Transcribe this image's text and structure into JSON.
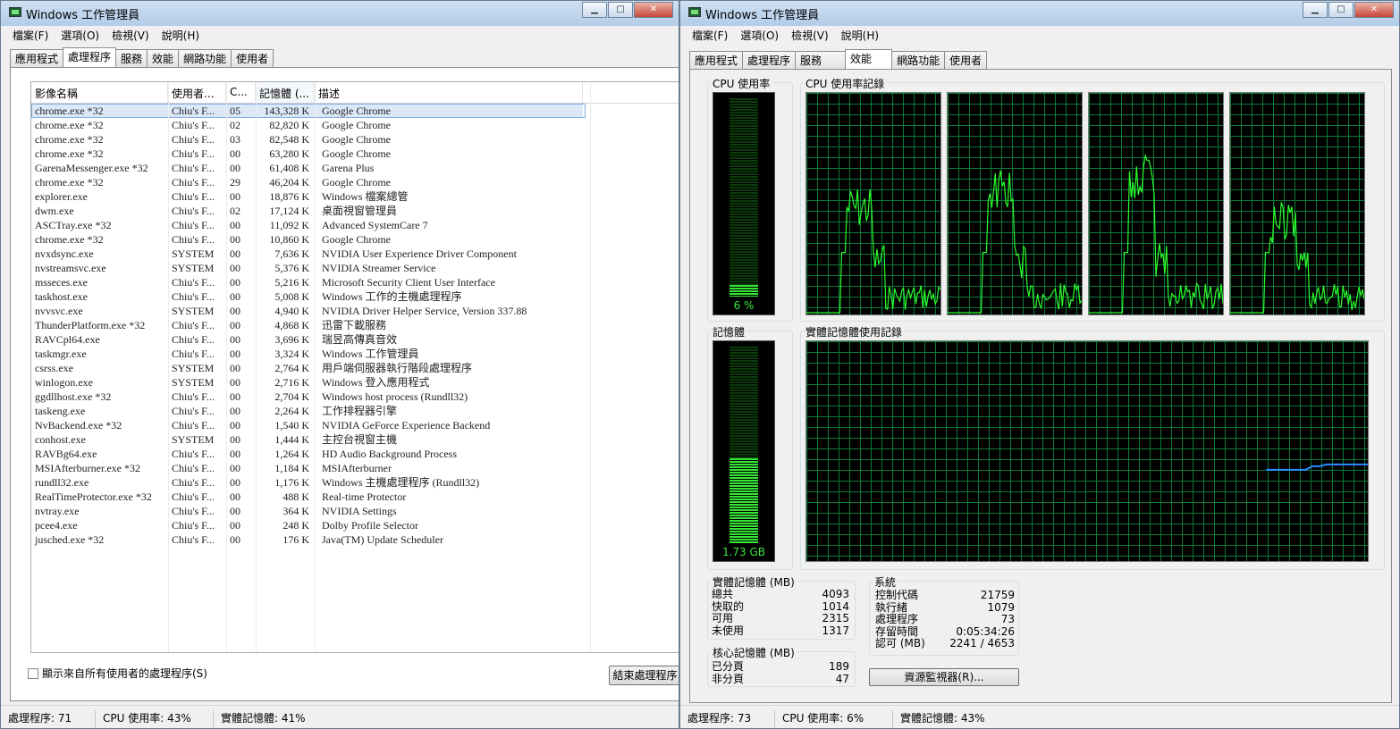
{
  "left": {
    "title": "Windows 工作管理員",
    "menus": [
      "檔案(F)",
      "選項(O)",
      "檢視(V)",
      "說明(H)"
    ],
    "tabs": [
      "應用程式",
      "處理程序",
      "服務",
      "效能",
      "網路功能",
      "使用者"
    ],
    "active_tab": 1,
    "columns": [
      "影像名稱",
      "使用者...",
      "C...",
      "記憶體 (...",
      "描述"
    ],
    "rows": [
      [
        "chrome.exe *32",
        "Chiu's F...",
        "05",
        "143,328 K",
        "Google Chrome"
      ],
      [
        "chrome.exe *32",
        "Chiu's F...",
        "02",
        "82,820 K",
        "Google Chrome"
      ],
      [
        "chrome.exe *32",
        "Chiu's F...",
        "03",
        "82,548 K",
        "Google Chrome"
      ],
      [
        "chrome.exe *32",
        "Chiu's F...",
        "00",
        "63,280 K",
        "Google Chrome"
      ],
      [
        "GarenaMessenger.exe *32",
        "Chiu's F...",
        "00",
        "61,408 K",
        "Garena Plus"
      ],
      [
        "chrome.exe *32",
        "Chiu's F...",
        "29",
        "46,204 K",
        "Google Chrome"
      ],
      [
        "explorer.exe",
        "Chiu's F...",
        "00",
        "18,876 K",
        "Windows 檔案總管"
      ],
      [
        "dwm.exe",
        "Chiu's F...",
        "02",
        "17,124 K",
        "桌面視窗管理員"
      ],
      [
        "ASCTray.exe *32",
        "Chiu's F...",
        "00",
        "11,092 K",
        "Advanced SystemCare 7"
      ],
      [
        "chrome.exe *32",
        "Chiu's F...",
        "00",
        "10,860 K",
        "Google Chrome"
      ],
      [
        "nvxdsync.exe",
        "SYSTEM",
        "00",
        "7,636 K",
        "NVIDIA User Experience Driver Component"
      ],
      [
        "nvstreamsvc.exe",
        "SYSTEM",
        "00",
        "5,376 K",
        "NVIDIA Streamer Service"
      ],
      [
        "msseces.exe",
        "Chiu's F...",
        "00",
        "5,216 K",
        "Microsoft Security Client User Interface"
      ],
      [
        "taskhost.exe",
        "Chiu's F...",
        "00",
        "5,008 K",
        "Windows 工作的主機處理程序"
      ],
      [
        "nvvsvc.exe",
        "SYSTEM",
        "00",
        "4,940 K",
        "NVIDIA Driver Helper Service, Version 337.88"
      ],
      [
        "ThunderPlatform.exe *32",
        "Chiu's F...",
        "00",
        "4,868 K",
        "迅雷下載服務"
      ],
      [
        "RAVCpl64.exe",
        "Chiu's F...",
        "00",
        "3,696 K",
        "瑞昱高傳真音效"
      ],
      [
        "taskmgr.exe",
        "Chiu's F...",
        "00",
        "3,324 K",
        "Windows 工作管理員"
      ],
      [
        "csrss.exe",
        "SYSTEM",
        "00",
        "2,764 K",
        "用戶端伺服器執行階段處理程序"
      ],
      [
        "winlogon.exe",
        "SYSTEM",
        "00",
        "2,716 K",
        "Windows 登入應用程式"
      ],
      [
        "ggdllhost.exe *32",
        "Chiu's F...",
        "00",
        "2,704 K",
        "Windows host process (Rundll32)"
      ],
      [
        "taskeng.exe",
        "Chiu's F...",
        "00",
        "2,264 K",
        "工作排程器引擎"
      ],
      [
        "NvBackend.exe *32",
        "Chiu's F...",
        "00",
        "1,540 K",
        "NVIDIA GeForce Experience Backend"
      ],
      [
        "conhost.exe",
        "SYSTEM",
        "00",
        "1,444 K",
        "主控台視窗主機"
      ],
      [
        "RAVBg64.exe",
        "Chiu's F...",
        "00",
        "1,264 K",
        "HD Audio Background Process"
      ],
      [
        "MSIAfterburner.exe *32",
        "Chiu's F...",
        "00",
        "1,184 K",
        "MSIAfterburner"
      ],
      [
        "rundll32.exe",
        "Chiu's F...",
        "00",
        "1,176 K",
        "Windows 主機處理程序 (Rundll32)"
      ],
      [
        "RealTimeProtector.exe *32",
        "Chiu's F...",
        "00",
        "488 K",
        "Real-time Protector"
      ],
      [
        "nvtray.exe",
        "Chiu's F...",
        "00",
        "364 K",
        "NVIDIA Settings"
      ],
      [
        "pcee4.exe",
        "Chiu's F...",
        "00",
        "248 K",
        "Dolby Profile Selector"
      ],
      [
        "jusched.exe *32",
        "Chiu's F...",
        "00",
        "176 K",
        "Java(TM) Update Scheduler"
      ]
    ],
    "show_all_label": "顯示來自所有使用者的處理程序(S)",
    "end_process_label": "結束處理程序",
    "status": [
      "處理程序: 71",
      "CPU 使用率: 43%",
      "實體記憶體: 41%"
    ]
  },
  "right": {
    "title": "Windows 工作管理員",
    "menus": [
      "檔案(F)",
      "選項(O)",
      "檢視(V)",
      "說明(H)"
    ],
    "tabs": [
      "應用程式",
      "處理程序",
      "服務",
      "效能",
      "網路功能",
      "使用者"
    ],
    "active_tab": 3,
    "cpu_usage_title": "CPU 使用率",
    "cpu_usage_label": "6 %",
    "cpu_usage_value": 0.06,
    "cpu_history_title": "CPU 使用率記錄",
    "memory_title": "記憶體",
    "memory_label": "1.73 GB",
    "memory_fraction": 0.43,
    "memory_history_title": "實體記憶體使用記錄",
    "physical_memory": {
      "title": "實體記憶體 (MB)",
      "items": [
        [
          "總共",
          "4093"
        ],
        [
          "快取的",
          "1014"
        ],
        [
          "可用",
          "2315"
        ],
        [
          "未使用",
          "1317"
        ]
      ]
    },
    "kernel_memory": {
      "title": "核心記憶體 (MB)",
      "items": [
        [
          "已分頁",
          "189"
        ],
        [
          "非分頁",
          "47"
        ]
      ]
    },
    "system": {
      "title": "系統",
      "items": [
        [
          "控制代碼",
          "21759"
        ],
        [
          "執行緒",
          "1079"
        ],
        [
          "處理程序",
          "73"
        ],
        [
          "存留時間",
          "0:05:34:26"
        ],
        [
          "認可 (MB)",
          "2241 / 4653"
        ]
      ]
    },
    "resource_monitor_label": "資源監視器(R)...",
    "status": [
      "處理程序: 73",
      "CPU 使用率: 6%",
      "實體記憶體: 43%"
    ]
  },
  "colors": {
    "graph_line": "#2bff2b",
    "memory_line": "#2a8cff",
    "grid": "#0b7a3a"
  }
}
